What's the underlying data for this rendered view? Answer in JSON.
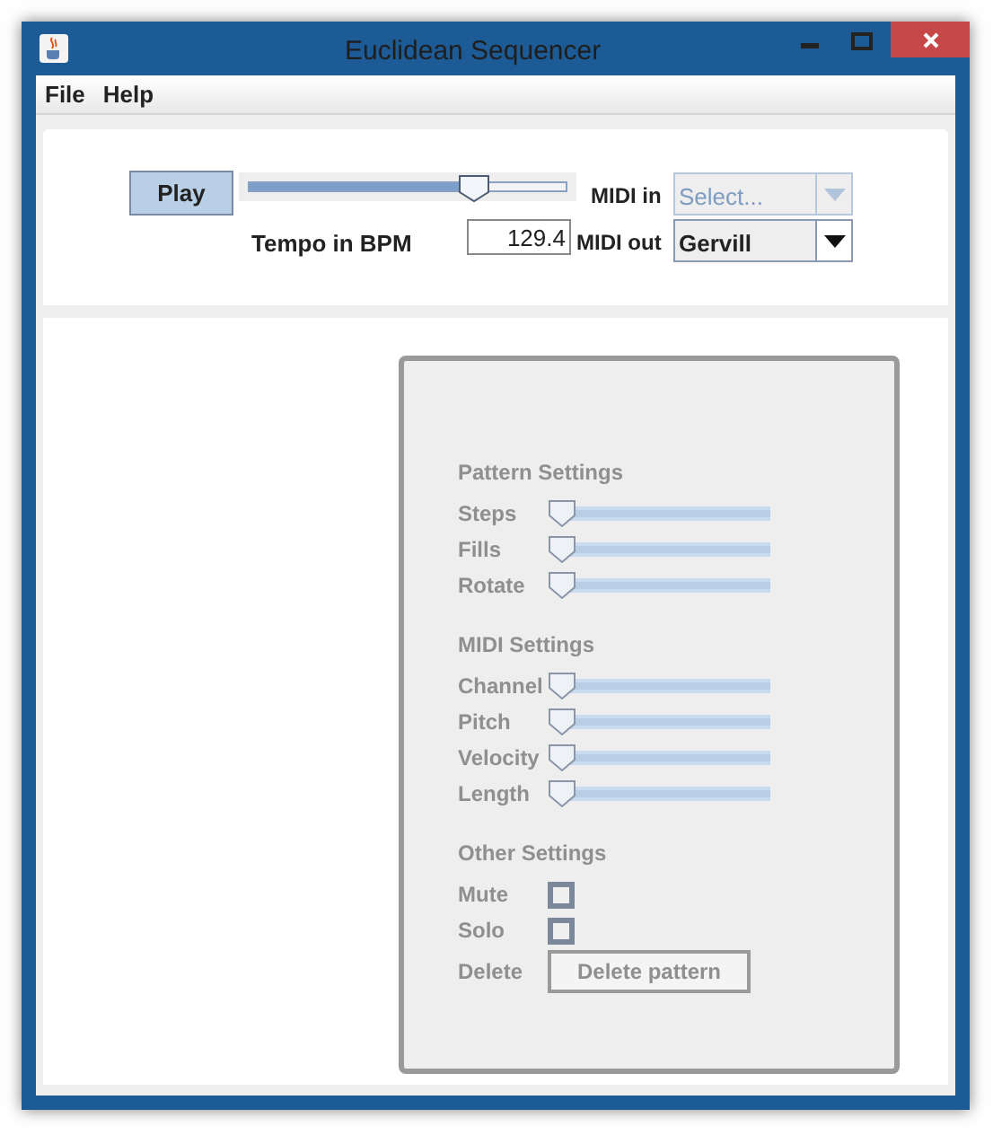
{
  "window": {
    "title": "Euclidean Sequencer"
  },
  "menu": [
    "File",
    "Help"
  ],
  "transport": {
    "play": "Play",
    "tempo_slider": {
      "level": 0.71
    },
    "tempo_label": "Tempo in BPM",
    "tempo_value": "129.4"
  },
  "midi_in": {
    "label": "MIDI in",
    "placeholder": "Select...",
    "disabled": true
  },
  "midi_out": {
    "label": "MIDI out",
    "value": "Gervill",
    "disabled": false
  },
  "settings_panel": {
    "disabled": true,
    "sections": [
      {
        "title": "Pattern Settings",
        "rows": [
          {
            "kind": "slider",
            "label": "Steps",
            "level": 0
          },
          {
            "kind": "slider",
            "label": "Fills",
            "level": 0
          },
          {
            "kind": "slider",
            "label": "Rotate",
            "level": 0
          }
        ]
      },
      {
        "title": "MIDI Settings",
        "rows": [
          {
            "kind": "slider",
            "label": "Channel",
            "level": 0
          },
          {
            "kind": "slider",
            "label": "Pitch",
            "level": 0
          },
          {
            "kind": "slider",
            "label": "Velocity",
            "level": 0
          },
          {
            "kind": "slider",
            "label": "Length",
            "level": 0
          }
        ]
      },
      {
        "title": "Other Settings",
        "rows": [
          {
            "kind": "checkbox",
            "label": "Mute",
            "checked": false
          },
          {
            "kind": "checkbox",
            "label": "Solo",
            "checked": false
          },
          {
            "kind": "button",
            "label": "Delete",
            "button": "Delete pattern"
          }
        ]
      }
    ]
  }
}
